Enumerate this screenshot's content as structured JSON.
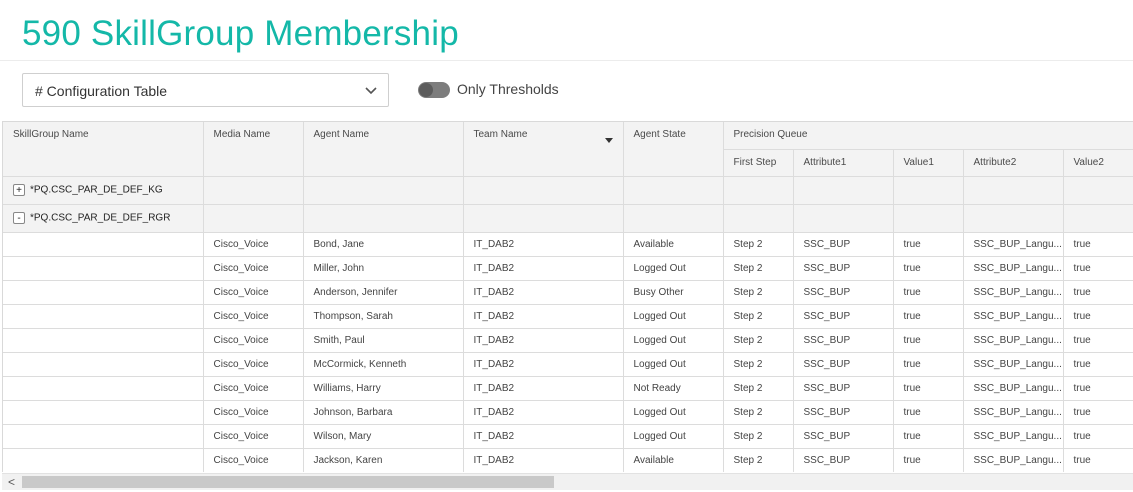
{
  "page": {
    "title": "590 SkillGroup Membership",
    "dropdown_value": "# Configuration Table",
    "toggle_label": "Only Thresholds"
  },
  "table": {
    "headers": {
      "skillgroup": "SkillGroup Name",
      "media": "Media Name",
      "agent": "Agent Name",
      "team": "Team Name",
      "state": "Agent State",
      "precision": "Precision Queue",
      "first_step": "First Step",
      "attr1": "Attribute1",
      "value1": "Value1",
      "attr2": "Attribute2",
      "value2": "Value2"
    },
    "groups": [
      {
        "expand": "+",
        "name": "*PQ.CSC_PAR_DE_DEF_KG"
      },
      {
        "expand": "-",
        "name": "*PQ.CSC_PAR_DE_DEF_RGR"
      }
    ],
    "rows": [
      {
        "media": "Cisco_Voice",
        "agent": "Bond, Jane",
        "team": "IT_DAB2",
        "state": "Available",
        "step": "Step 2",
        "attr1": "SSC_BUP",
        "value1": "true",
        "attr2": "SSC_BUP_Langu...",
        "value2": "true"
      },
      {
        "media": "Cisco_Voice",
        "agent": "Miller, John",
        "team": "IT_DAB2",
        "state": "Logged Out",
        "step": "Step 2",
        "attr1": "SSC_BUP",
        "value1": "true",
        "attr2": "SSC_BUP_Langu...",
        "value2": "true"
      },
      {
        "media": "Cisco_Voice",
        "agent": "Anderson, Jennifer",
        "team": "IT_DAB2",
        "state": "Busy Other",
        "step": "Step 2",
        "attr1": "SSC_BUP",
        "value1": "true",
        "attr2": "SSC_BUP_Langu...",
        "value2": "true"
      },
      {
        "media": "Cisco_Voice",
        "agent": "Thompson, Sarah",
        "team": "IT_DAB2",
        "state": "Logged Out",
        "step": "Step 2",
        "attr1": "SSC_BUP",
        "value1": "true",
        "attr2": "SSC_BUP_Langu...",
        "value2": "true"
      },
      {
        "media": "Cisco_Voice",
        "agent": "Smith, Paul",
        "team": "IT_DAB2",
        "state": "Logged Out",
        "step": "Step 2",
        "attr1": "SSC_BUP",
        "value1": "true",
        "attr2": "SSC_BUP_Langu...",
        "value2": "true"
      },
      {
        "media": "Cisco_Voice",
        "agent": "McCormick, Kenneth",
        "team": "IT_DAB2",
        "state": "Logged Out",
        "step": "Step 2",
        "attr1": "SSC_BUP",
        "value1": "true",
        "attr2": "SSC_BUP_Langu...",
        "value2": "true"
      },
      {
        "media": "Cisco_Voice",
        "agent": "Williams, Harry",
        "team": "IT_DAB2",
        "state": "Not Ready",
        "step": "Step 2",
        "attr1": "SSC_BUP",
        "value1": "true",
        "attr2": "SSC_BUP_Langu...",
        "value2": "true"
      },
      {
        "media": "Cisco_Voice",
        "agent": "Johnson, Barbara",
        "team": "IT_DAB2",
        "state": "Logged Out",
        "step": "Step 2",
        "attr1": "SSC_BUP",
        "value1": "true",
        "attr2": "SSC_BUP_Langu...",
        "value2": "true"
      },
      {
        "media": "Cisco_Voice",
        "agent": "Wilson, Mary",
        "team": "IT_DAB2",
        "state": "Logged Out",
        "step": "Step 2",
        "attr1": "SSC_BUP",
        "value1": "true",
        "attr2": "SSC_BUP_Langu...",
        "value2": "true"
      },
      {
        "media": "Cisco_Voice",
        "agent": "Jackson, Karen",
        "team": "IT_DAB2",
        "state": "Available",
        "step": "Step 2",
        "attr1": "SSC_BUP",
        "value1": "true",
        "attr2": "SSC_BUP_Langu...",
        "value2": "true"
      }
    ]
  },
  "scrollbar": {
    "left_arrow": "<"
  }
}
